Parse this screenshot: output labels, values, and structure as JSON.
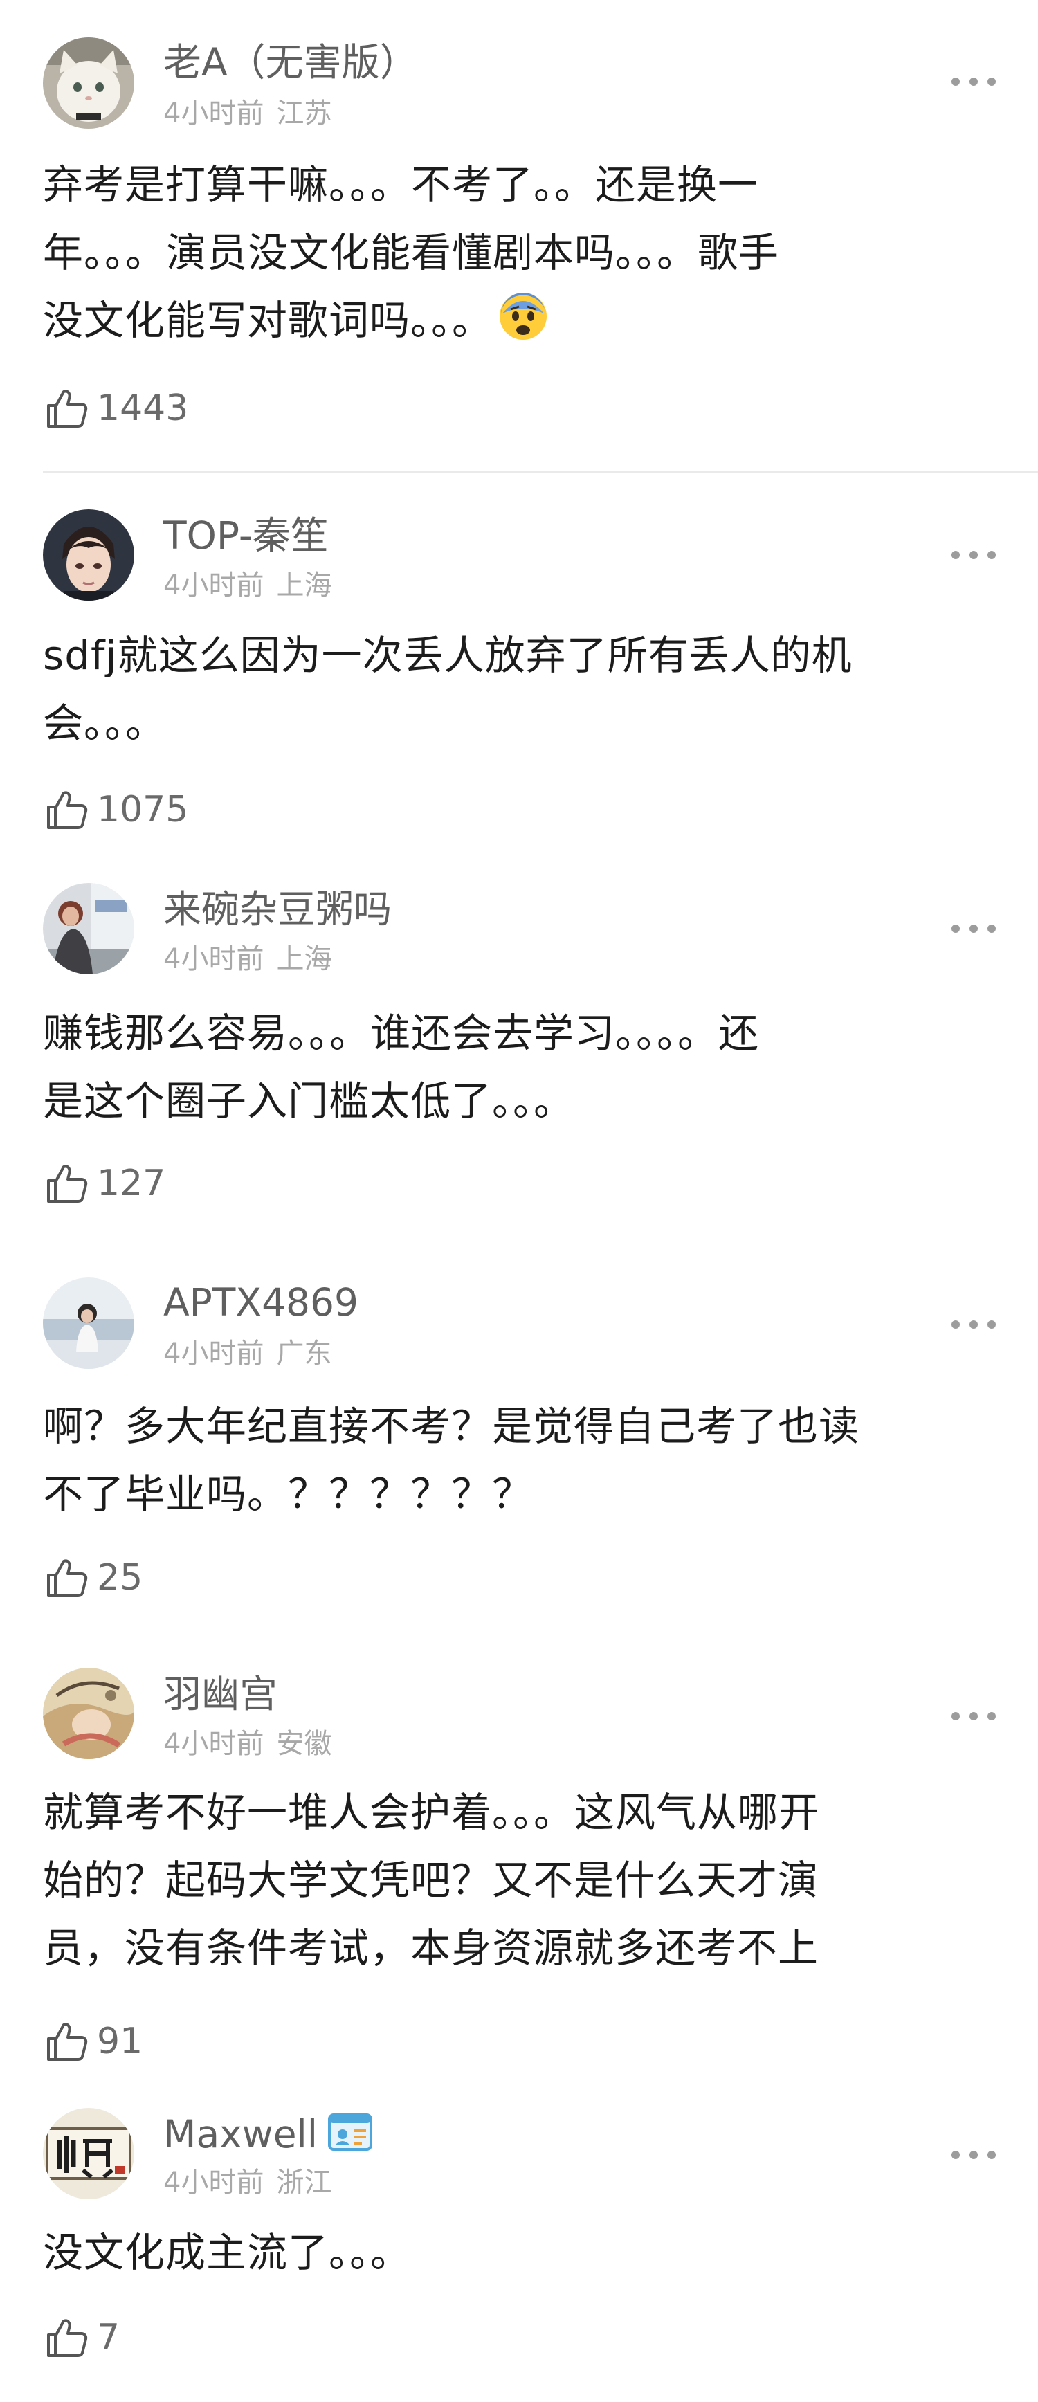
{
  "comments": [
    {
      "name": "老A（无害版）",
      "time": "4小时前",
      "location": "江苏",
      "lines": [
        "弃考是打算干嘛。。。不考了。。还是换一",
        "年。。。演员没文化能看懂剧本吗。。。歌手",
        "没文化能写对歌词吗。。。"
      ],
      "likes": "1443",
      "avatar_icon": "white-cat-avatar",
      "trailing_emoji": "fearful-face-emoji"
    },
    {
      "name": "TOP-秦笙",
      "time": "4小时前",
      "location": "上海",
      "lines": [
        "sdfj就这么因为一次丢人放弃了所有丢人的机",
        "会。。。"
      ],
      "likes": "1075",
      "avatar_icon": "anime-man-avatar"
    },
    {
      "name": "来碗杂豆粥吗",
      "time": "4小时前",
      "location": "上海",
      "lines": [
        "赚钱那么容易。。。谁还会去学习。。。。还",
        "是这个圈子入门槛太低了。。。"
      ],
      "likes": "127",
      "avatar_icon": "person-photo-avatar"
    },
    {
      "name": "APTX4869",
      "time": "4小时前",
      "location": "广东",
      "lines": [
        "啊？多大年纪直接不考？是觉得自己考了也读",
        "不了毕业吗。？？？？？？"
      ],
      "likes": "25",
      "avatar_icon": "girl-sea-avatar"
    },
    {
      "name": "羽幽宫",
      "time": "4小时前",
      "location": "安徽",
      "lines": [
        "就算考不好一堆人会护着。。。这风气从哪开",
        "始的？起码大学文凭吧？又不是什么天才演",
        "员，没有条件考试，本身资源就多还考不上"
      ],
      "likes": "91",
      "avatar_icon": "illustration-avatar"
    },
    {
      "name": "Maxwell",
      "time": "4小时前",
      "location": "浙江",
      "lines": [
        "没文化成主流了。。。"
      ],
      "likes": "7",
      "avatar_icon": "calligraphy-avatar",
      "badge_icon": "id-card-badge-icon"
    }
  ],
  "colors": {
    "name": "#5f5f5f",
    "meta": "#a8a8a8",
    "body": "#1c1c1c",
    "divider": "#eaeaea"
  }
}
